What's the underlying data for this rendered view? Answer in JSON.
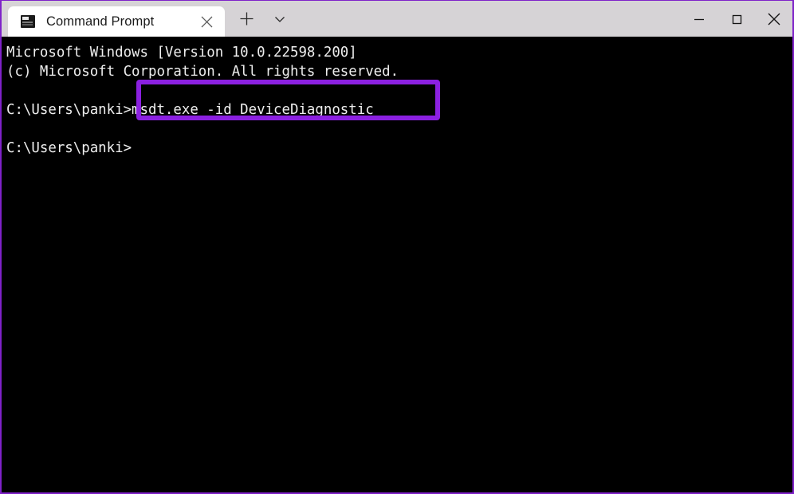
{
  "window": {
    "accent_color": "#7f22c9",
    "titlebar_bg": "#d6d3d6",
    "terminal_bg": "#000000",
    "terminal_fg": "#eeeeee",
    "highlight_color": "#8b20e0"
  },
  "titlebar": {
    "tabs": [
      {
        "label": "Command Prompt",
        "icon": "console-icon",
        "close_label": "×",
        "active": true
      }
    ],
    "new_tab_label": "+",
    "dropdown_label": "⌄",
    "controls": {
      "minimize_label": "—",
      "maximize_label": "□",
      "close_label": "×"
    }
  },
  "terminal": {
    "lines": [
      {
        "id": "banner-version",
        "text": "Microsoft Windows [Version 10.0.22598.200]"
      },
      {
        "id": "banner-copyright",
        "text": "(c) Microsoft Corporation. All rights reserved."
      },
      {
        "id": "blank-1",
        "text": " "
      },
      {
        "id": "command-line",
        "prompt": "C:\\Users\\panki>",
        "command": "msdt.exe -id DeviceDiagnostic"
      },
      {
        "id": "blank-2",
        "text": " "
      },
      {
        "id": "prompt-line",
        "text": "C:\\Users\\panki>"
      }
    ],
    "command_full": "C:\\Users\\panki>msdt.exe -id DeviceDiagnostic",
    "highlight_target": "msdt.exe -id DeviceDiagnostic"
  }
}
